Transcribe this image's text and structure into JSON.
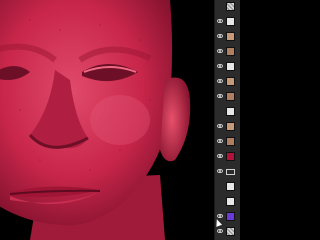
{
  "canvas": {
    "subject": "3d-head-render",
    "skin_color": "#d2284e",
    "background_color": "#000000"
  },
  "layers_panel": {
    "panel_color": "#2b2b2b",
    "layers": [
      {
        "kind": "checker",
        "visible": false,
        "name_icon": "pattern-icon"
      },
      {
        "kind": "white",
        "visible": true,
        "name_icon": "layer-thumbnail-icon"
      },
      {
        "kind": "tan",
        "visible": true,
        "name_icon": "layer-thumbnail-icon"
      },
      {
        "kind": "tan2",
        "visible": true,
        "name_icon": "layer-thumbnail-icon"
      },
      {
        "kind": "white",
        "visible": true,
        "name_icon": "layer-thumbnail-icon"
      },
      {
        "kind": "tan",
        "visible": true,
        "name_icon": "layer-thumbnail-icon"
      },
      {
        "kind": "tan2",
        "visible": true,
        "name_icon": "layer-thumbnail-icon"
      },
      {
        "kind": "white",
        "visible": false,
        "name_icon": "layer-thumbnail-icon"
      },
      {
        "kind": "tan",
        "visible": true,
        "name_icon": "layer-thumbnail-icon"
      },
      {
        "kind": "tan2",
        "visible": true,
        "name_icon": "layer-thumbnail-icon"
      },
      {
        "kind": "red",
        "visible": true,
        "name_icon": "color-fill-icon"
      },
      {
        "kind": "folder",
        "visible": true,
        "name_icon": "folder-icon"
      },
      {
        "kind": "white",
        "visible": false,
        "name_icon": "layer-thumbnail-icon"
      },
      {
        "kind": "white",
        "visible": false,
        "name_icon": "layer-thumbnail-icon"
      },
      {
        "kind": "purple",
        "visible": true,
        "name_icon": "color-fill-icon"
      },
      {
        "kind": "checker",
        "visible": true,
        "name_icon": "pattern-icon"
      }
    ]
  }
}
